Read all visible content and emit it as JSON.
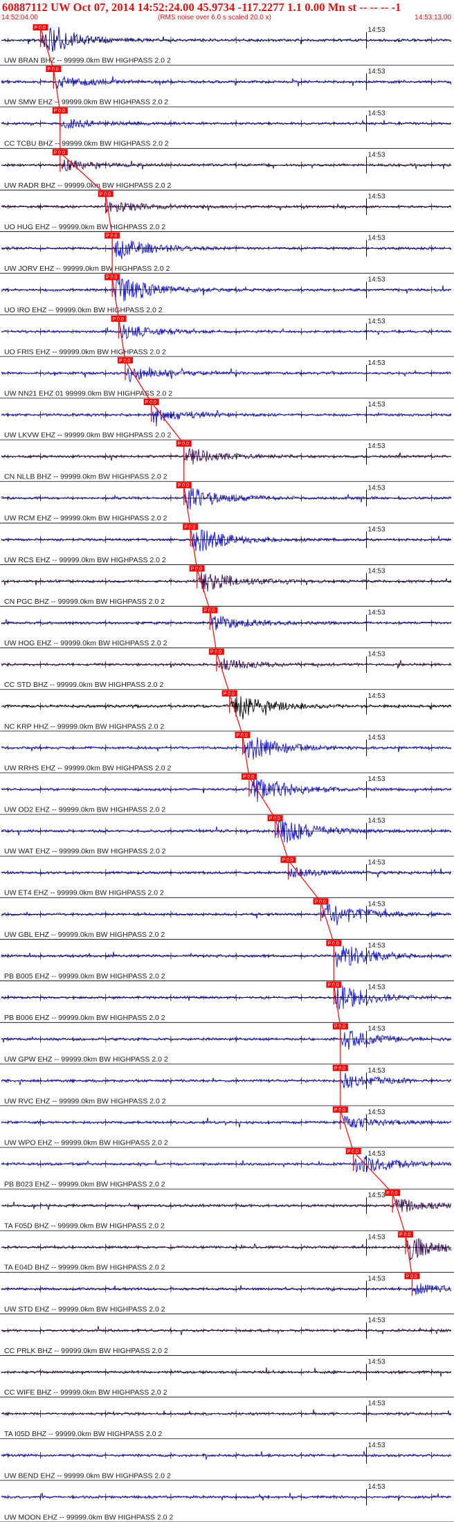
{
  "header": {
    "title": "60887112 UW Oct 07, 2014 14:52:24.00   45.9734 -117.2277  1.1 0.00 Mn st -- -- -- -1",
    "start_time": "14:52:04.00",
    "note": "(RMS noise over 6.0 s scaled 20.0 x)",
    "end_time": "14:53:13.00"
  },
  "colors": {
    "header": "#e01010",
    "pick": "#ff0000",
    "axis": "#000000"
  },
  "chart_data": {
    "type": "line",
    "title": "60887112 UW Oct 07, 2014 14:52:24.00   45.9734 -117.2277  1.1 0.00 Mn st -- -- -- -1",
    "time_range": [
      "14:52:04.00",
      "14:53:13.00"
    ],
    "minute_tick_label": "14:53",
    "minute_tick_time": "14:53:00",
    "filter_suffix": "99999.0km BW  HIGHPASS  2.0  2",
    "pick_label": "P 0.0",
    "traces": [
      {
        "label": "UW BRAN BHZ -- 99999.0km BW  HIGHPASS  2.0  2",
        "color": "#000080",
        "pick_time": "14:52:10.0",
        "peak_amp": 0.9
      },
      {
        "label": "UW SMW EHZ -- 99999.0km BW  HIGHPASS  2.0  2",
        "color": "#1010e0",
        "pick_time": "14:52:12.0",
        "peak_amp": 0.4
      },
      {
        "label": "CC TCBU BHZ -- 99999.0km BW  HIGHPASS  2.0  2",
        "color": "#1010e0",
        "pick_time": "14:52:13.0",
        "peak_amp": 0.35
      },
      {
        "label": "UW RADR BHZ -- 99999.0km BW  HIGHPASS  2.0  2",
        "color": "#3a0a5a",
        "pick_time": "14:52:13.0",
        "peak_amp": 0.35
      },
      {
        "label": "UO HUG EHZ -- 99999.0km BW  HIGHPASS  2.0  2",
        "color": "#3a0a5a",
        "pick_time": "14:52:20.0",
        "peak_amp": 0.4
      },
      {
        "label": "UW JORV EHZ -- 99999.0km BW  HIGHPASS  2.0  2",
        "color": "#1010e0",
        "pick_time": "14:52:21.0",
        "peak_amp": 0.8
      },
      {
        "label": "UO IRO EHZ -- 99999.0km BW  HIGHPASS  2.0  2",
        "color": "#1010e0",
        "pick_time": "14:52:21.0",
        "peak_amp": 1.0
      },
      {
        "label": "UO FRIS EHZ -- 99999.0km BW  HIGHPASS  2.0  2",
        "color": "#1010e0",
        "pick_time": "14:52:22.0",
        "peak_amp": 0.5
      },
      {
        "label": "UW NN21 EHZ 01 99999.0km BW  HIGHPASS  2.0  2",
        "color": "#1010e0",
        "pick_time": "14:52:23.0",
        "peak_amp": 0.5
      },
      {
        "label": "UW LKVW EHZ -- 99999.0km BW  HIGHPASS  2.0  2",
        "color": "#1010e0",
        "pick_time": "14:52:27.0",
        "peak_amp": 0.5
      },
      {
        "label": "CN NLLB BHZ -- 99999.0km BW  HIGHPASS  2.0  2",
        "color": "#3a0a5a",
        "pick_time": "14:52:32.0",
        "peak_amp": 0.55
      },
      {
        "label": "UW RCM EHZ -- 99999.0km BW  HIGHPASS  2.0  2",
        "color": "#1010e0",
        "pick_time": "14:52:32.0",
        "peak_amp": 0.7
      },
      {
        "label": "UW RCS EHZ -- 99999.0km BW  HIGHPASS  2.0  2",
        "color": "#1010e0",
        "pick_time": "14:52:33.0",
        "peak_amp": 0.9
      },
      {
        "label": "CN PGC BHZ -- 99999.0km BW  HIGHPASS  2.0  2",
        "color": "#3a0a5a",
        "pick_time": "14:52:34.0",
        "peak_amp": 0.75
      },
      {
        "label": "UW HOG EHZ -- 99999.0km BW  HIGHPASS  2.0  2",
        "color": "#1010e0",
        "pick_time": "14:52:36.0",
        "peak_amp": 0.5
      },
      {
        "label": "CC STD BHZ -- 99999.0km BW  HIGHPASS  2.0  2",
        "color": "#3a0a5a",
        "pick_time": "14:52:37.0",
        "peak_amp": 0.4
      },
      {
        "label": "NC KRP HHZ -- 99999.0km BW  HIGHPASS  2.0  2",
        "color": "#000000",
        "pick_time": "14:52:39.0",
        "peak_amp": 0.85
      },
      {
        "label": "UW RRHS EHZ -- 99999.0km BW  HIGHPASS  2.0  2",
        "color": "#1010e0",
        "pick_time": "14:52:41.0",
        "peak_amp": 0.9
      },
      {
        "label": "UW OD2 EHZ -- 99999.0km BW  HIGHPASS  2.0  2",
        "color": "#1010e0",
        "pick_time": "14:52:42.0",
        "peak_amp": 0.95
      },
      {
        "label": "UW WAT EHZ -- 99999.0km BW  HIGHPASS  2.0  2",
        "color": "#1010e0",
        "pick_time": "14:52:46.0",
        "peak_amp": 0.95
      },
      {
        "label": "UW ET4 EHZ -- 99999.0km BW  HIGHPASS  2.0  2",
        "color": "#1010e0",
        "pick_time": "14:52:48.0",
        "peak_amp": 0.3
      },
      {
        "label": "UW GBL EHZ -- 99999.0km BW  HIGHPASS  2.0  2",
        "color": "#1010e0",
        "pick_time": "14:52:53.0",
        "peak_amp": 1.0
      },
      {
        "label": "PB B005 EHZ -- 99999.0km BW  HIGHPASS  2.0  2",
        "color": "#1010e0",
        "pick_time": "14:52:55.0",
        "peak_amp": 0.85
      },
      {
        "label": "PB B006 EHZ -- 99999.0km BW  HIGHPASS  2.0  2",
        "color": "#1010e0",
        "pick_time": "14:52:55.0",
        "peak_amp": 0.85
      },
      {
        "label": "UW GPW EHZ -- 99999.0km BW  HIGHPASS  2.0  2",
        "color": "#1010e0",
        "pick_time": "14:52:56.0",
        "peak_amp": 0.6
      },
      {
        "label": "UW RVC EHZ -- 99999.0km BW  HIGHPASS  2.0  2",
        "color": "#1010e0",
        "pick_time": "14:52:56.0",
        "peak_amp": 0.5
      },
      {
        "label": "UW WPO EHZ -- 99999.0km BW  HIGHPASS  2.0  2",
        "color": "#1010e0",
        "pick_time": "14:52:56.0",
        "peak_amp": 0.4
      },
      {
        "label": "PB B023 EHZ -- 99999.0km BW  HIGHPASS  2.0  2",
        "color": "#1010e0",
        "pick_time": "14:52:58.0",
        "peak_amp": 0.7
      },
      {
        "label": "TA F05D BHZ -- 99999.0km BW  HIGHPASS  2.0  2",
        "color": "#3a0a5a",
        "pick_time": "14:53:04.0",
        "peak_amp": 0.45
      },
      {
        "label": "TA E04D BHZ -- 99999.0km BW  HIGHPASS  2.0  2",
        "color": "#3a0a5a",
        "pick_time": "14:53:06.0",
        "peak_amp": 0.8
      },
      {
        "label": "UW STD EHZ -- 99999.0km BW  HIGHPASS  2.0  2",
        "color": "#1010e0",
        "pick_time": "14:53:07.0",
        "peak_amp": 0.35
      },
      {
        "label": "CC PRLK BHZ -- 99999.0km BW  HIGHPASS  2.0  2",
        "color": "#3a0a5a",
        "pick_time": null,
        "peak_amp": 0.2
      },
      {
        "label": "CC WIFE BHZ -- 99999.0km BW  HIGHPASS  2.0  2",
        "color": "#3a0a5a",
        "pick_time": null,
        "peak_amp": 0.25
      },
      {
        "label": "TA I05D BHZ -- 99999.0km BW  HIGHPASS  2.0  2",
        "color": "#3a0a5a",
        "pick_time": null,
        "peak_amp": 0.3
      },
      {
        "label": "UW BEND EHZ -- 99999.0km BW  HIGHPASS  2.0  2",
        "color": "#1010e0",
        "pick_time": null,
        "peak_amp": 0.2
      },
      {
        "label": "UW MOON EHZ -- 99999.0km BW  HIGHPASS  2.0  2",
        "color": "#1010e0",
        "pick_time": null,
        "peak_amp": 0.2
      }
    ]
  }
}
